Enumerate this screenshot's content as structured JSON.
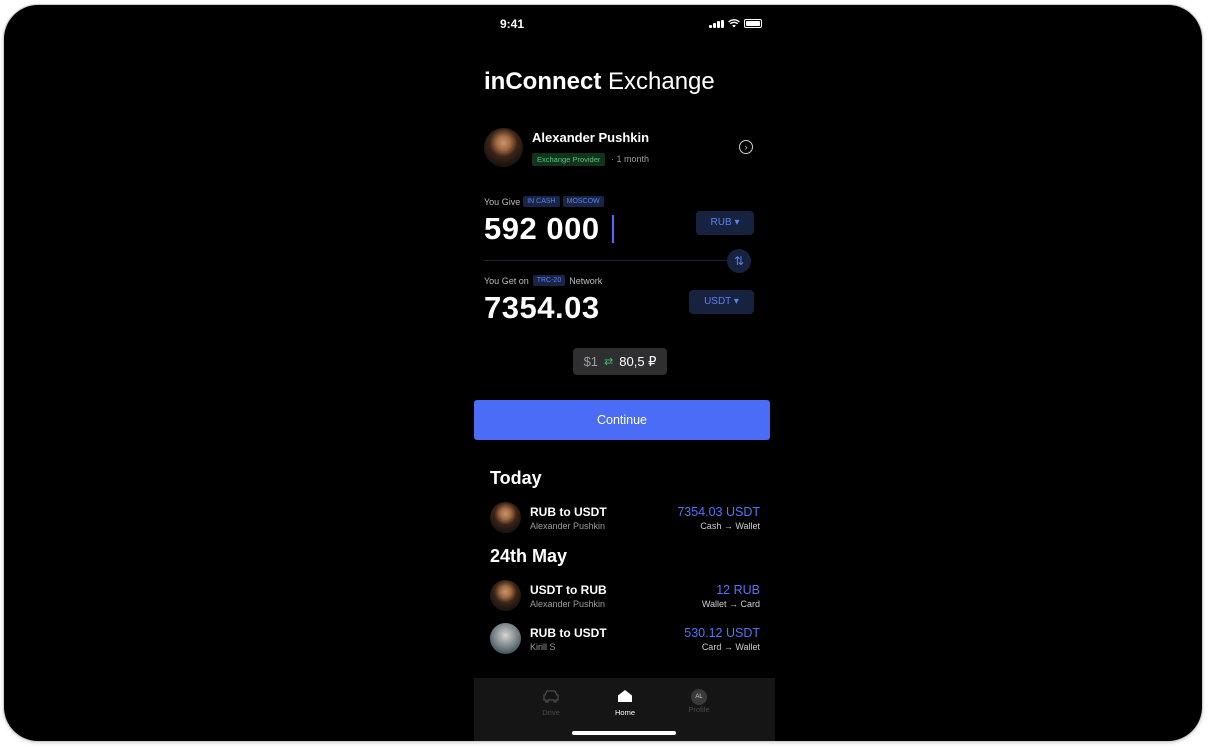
{
  "status_bar": {
    "time": "9:41"
  },
  "app": {
    "title_bold": "inConnect",
    "title_light": "Exchange"
  },
  "provider": {
    "name": "Alexander Pushkin",
    "badge": "Exchange Provider",
    "meta": "· 1 month"
  },
  "give": {
    "label": "You Give",
    "tags": [
      "IN CASH",
      "MOSCOW"
    ],
    "amount": "592 000",
    "currency": "RUB"
  },
  "get": {
    "label": "You Get on",
    "network_tag": "TRC-20",
    "network_word": "Network",
    "amount": "7354.03",
    "currency": "USDT"
  },
  "rate": {
    "left": "$1",
    "right": "80,5 ₽"
  },
  "continue_label": "Continue",
  "sections": [
    {
      "heading": "Today",
      "items": [
        {
          "title": "RUB to USDT",
          "person": "Alexander Pushkin",
          "amount": "7354.03 USDT",
          "route": "Cash → Wallet",
          "avatar": "pushkin"
        }
      ]
    },
    {
      "heading": "24th May",
      "items": [
        {
          "title": "USDT to RUB",
          "person": "Alexander Pushkin",
          "amount": "12 RUB",
          "route": "Wallet → Card",
          "avatar": "pushkin"
        },
        {
          "title": "RUB to USDT",
          "person": "Kirill S",
          "amount": "530.12 USDT",
          "route": "Card → Wallet",
          "avatar": "kirill"
        }
      ]
    }
  ],
  "tabbar": {
    "tabs": [
      {
        "label": "Drive",
        "icon": "car-icon",
        "active": false
      },
      {
        "label": "Home",
        "icon": "home-icon",
        "active": true
      },
      {
        "label": "Profile",
        "icon": "profile-avatar-icon",
        "active": false,
        "initials": "AL"
      }
    ]
  },
  "colors": {
    "accent": "#4a6cf7",
    "amount_blue": "#5475f4",
    "badge_green": "#58c27a",
    "background": "#000000"
  }
}
